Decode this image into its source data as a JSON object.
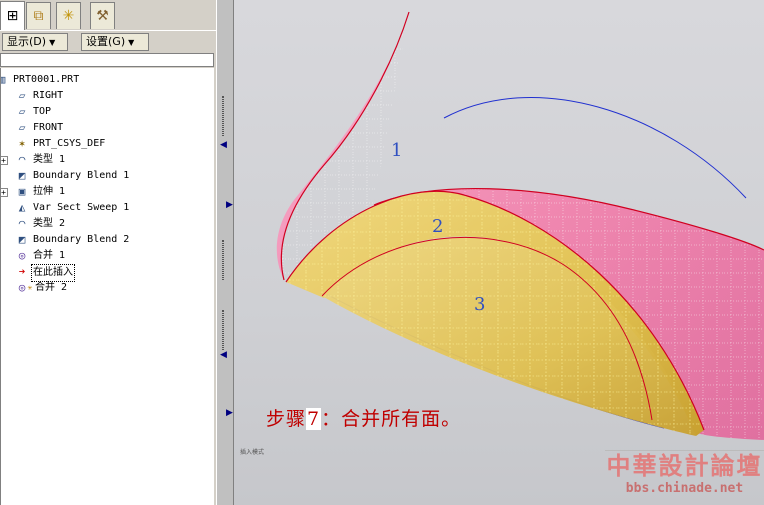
{
  "tabs": [
    {
      "icon": "model-tree-icon",
      "glyph": "⊞"
    },
    {
      "icon": "folder-browser-icon",
      "glyph": "⧉"
    },
    {
      "icon": "favorites-icon",
      "glyph": "✳"
    },
    {
      "icon": "tools-icon",
      "glyph": "⚒"
    }
  ],
  "toolbar": {
    "show_label": "显示(D)",
    "settings_label": "设置(G)"
  },
  "tree": {
    "root": "PRT0001.PRT",
    "items": [
      {
        "label": "RIGHT",
        "icon": "datum-plane-icon",
        "glyph": "▱"
      },
      {
        "label": "TOP",
        "icon": "datum-plane-icon",
        "glyph": "▱"
      },
      {
        "label": "FRONT",
        "icon": "datum-plane-icon",
        "glyph": "▱"
      },
      {
        "label": "PRT_CSYS_DEF",
        "icon": "coordinate-system-icon",
        "glyph": "✶"
      },
      {
        "label": "类型 1",
        "icon": "surface-feature-icon",
        "glyph": "◠",
        "expandable": true
      },
      {
        "label": "Boundary Blend 1",
        "icon": "boundary-blend-icon",
        "glyph": "◩"
      },
      {
        "label": "拉伸 1",
        "icon": "extrude-icon",
        "glyph": "▣",
        "expandable": true
      },
      {
        "label": "Var Sect Sweep 1",
        "icon": "sweep-icon",
        "glyph": "◭"
      },
      {
        "label": "类型 2",
        "icon": "surface-feature-icon",
        "glyph": "◠"
      },
      {
        "label": "Boundary Blend 2",
        "icon": "boundary-blend-icon",
        "glyph": "◩"
      },
      {
        "label": "合并 1",
        "icon": "merge-icon",
        "glyph": "◎"
      },
      {
        "label": "在此插入",
        "icon": "insert-here-arrow-icon",
        "glyph": "➔",
        "insert": true
      },
      {
        "label": "合并 2",
        "icon": "merge-icon",
        "glyph": "◎",
        "suppressed": true
      }
    ]
  },
  "surfaces": {
    "label_1": "1",
    "label_2": "2",
    "label_3": "3"
  },
  "caption": {
    "prefix": "步骤",
    "number": "7",
    "suffix": "：合并所有面。"
  },
  "view_tag": "插入模式",
  "watermark": {
    "title": "中華設計論壇",
    "url": "bbs.chinade.net"
  },
  "colors": {
    "surface1": "#f090b8",
    "surface2": "#e8c860",
    "edge": "#d00020",
    "curve": "#2030d0",
    "caption": "#c00000",
    "label": "#3050c0"
  }
}
